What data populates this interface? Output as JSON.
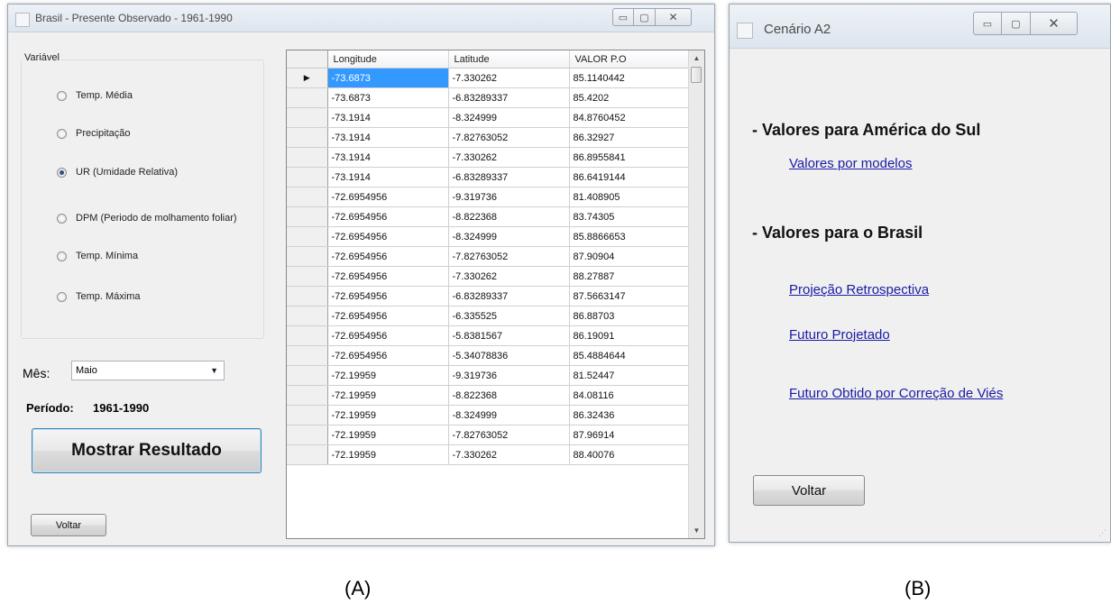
{
  "windowA": {
    "title": "Brasil  - Presente Observado - 1961-1990",
    "group_label": "Variável",
    "options": [
      {
        "label": "Temp. Média",
        "checked": false
      },
      {
        "label": "Precipitação",
        "checked": false
      },
      {
        "label": "UR (Umidade Relativa)",
        "checked": true
      },
      {
        "label": "DPM (Periodo de molhamento foliar)",
        "checked": false
      },
      {
        "label": "Temp. Mínima",
        "checked": false
      },
      {
        "label": "Temp. Máxima",
        "checked": false
      }
    ],
    "month_label": "Mês:",
    "month_value": "Maio",
    "period_label": "Período:",
    "period_value": "1961-1990",
    "show_button": "Mostrar Resultado",
    "back_button": "Voltar",
    "grid": {
      "columns": [
        "Longitude",
        "Latitude",
        "VALOR P.O"
      ],
      "current_row_marker": "▶",
      "rows": [
        [
          "-73.6873",
          "-7.330262",
          "85.1140442"
        ],
        [
          "-73.6873",
          "-6.83289337",
          "85.4202"
        ],
        [
          "-73.1914",
          "-8.324999",
          "84.8760452"
        ],
        [
          "-73.1914",
          "-7.82763052",
          "86.32927"
        ],
        [
          "-73.1914",
          "-7.330262",
          "86.8955841"
        ],
        [
          "-73.1914",
          "-6.83289337",
          "86.6419144"
        ],
        [
          "-72.6954956",
          "-9.319736",
          "81.408905"
        ],
        [
          "-72.6954956",
          "-8.822368",
          "83.74305"
        ],
        [
          "-72.6954956",
          "-8.324999",
          "85.8866653"
        ],
        [
          "-72.6954956",
          "-7.82763052",
          "87.90904"
        ],
        [
          "-72.6954956",
          "-7.330262",
          "88.27887"
        ],
        [
          "-72.6954956",
          "-6.83289337",
          "87.5663147"
        ],
        [
          "-72.6954956",
          "-6.335525",
          "86.88703"
        ],
        [
          "-72.6954956",
          "-5.8381567",
          "86.19091"
        ],
        [
          "-72.6954956",
          "-5.34078836",
          "85.4884644"
        ],
        [
          "-72.19959",
          "-9.319736",
          "81.52447"
        ],
        [
          "-72.19959",
          "-8.822368",
          "84.08116"
        ],
        [
          "-72.19959",
          "-8.324999",
          "86.32436"
        ],
        [
          "-72.19959",
          "-7.82763052",
          "87.96914"
        ],
        [
          "-72.19959",
          "-7.330262",
          "88.40076"
        ]
      ]
    }
  },
  "windowB": {
    "title": "Cenário A2",
    "heading_sa": "- Valores para América do Sul",
    "link_models": "Valores por modelos",
    "heading_br": "- Valores para o Brasil",
    "link_retro": "Projeção Retrospectiva",
    "link_future": "Futuro Projetado",
    "link_bias": "Futuro Obtido por Correção de Viés",
    "back_button": "Voltar"
  },
  "captions": {
    "a": "(A)",
    "b": "(B)"
  },
  "icons": {
    "minimize": "minimize-icon",
    "maximize": "maximize-icon",
    "close": "close-icon",
    "dropdown": "chevron-down-icon",
    "row_marker": "row-pointer-icon"
  }
}
